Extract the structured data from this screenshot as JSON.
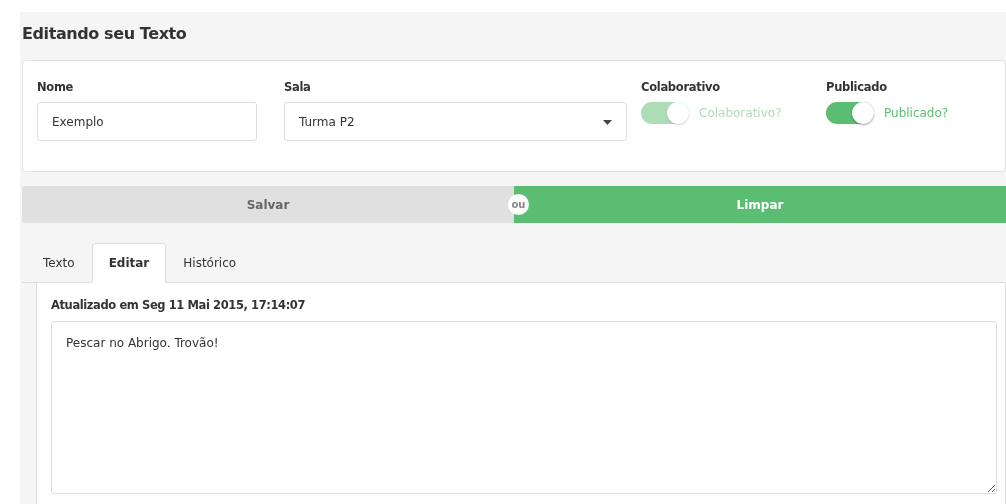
{
  "title": "Editando seu Texto",
  "form": {
    "fields": [
      {
        "kind": "text",
        "label": "Nome",
        "value": "Exemplo"
      },
      {
        "kind": "select",
        "label": "Sala",
        "value": "Turma P2"
      },
      {
        "kind": "toggle",
        "label": "Colaborativo",
        "text": "Colaborativo?",
        "on": true,
        "disabled": true
      },
      {
        "kind": "toggle",
        "label": "Publicado",
        "text": "Publicado?",
        "on": true,
        "disabled": false
      }
    ]
  },
  "actions": {
    "primary": "Salvar",
    "separator": "ou",
    "secondary": "Limpar"
  },
  "tabs": [
    {
      "label": "Texto",
      "selected": false
    },
    {
      "label": "Editar",
      "selected": true
    },
    {
      "label": "Histórico",
      "selected": false
    }
  ],
  "editor": {
    "updated": "Atualizado em Seg 11 Mai 2015, 17:14:07",
    "content": "Pescar no Abrigo. Trovão!"
  }
}
